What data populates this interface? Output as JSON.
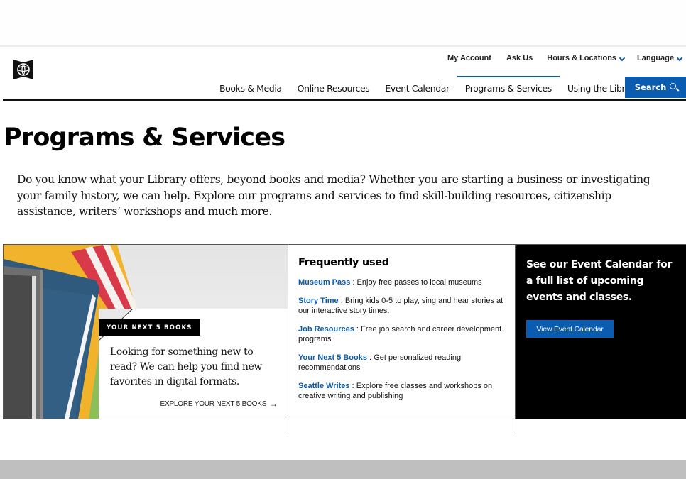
{
  "header": {
    "logo_icon": "library-globe-logo-icon",
    "utility_nav": [
      {
        "label": "My Account"
      },
      {
        "label": "Ask Us"
      },
      {
        "label": "Hours & Locations",
        "dropdown": true
      },
      {
        "label": "Language",
        "dropdown": true
      }
    ],
    "main_nav": [
      {
        "label": "Books & Media"
      },
      {
        "label": "Online Resources"
      },
      {
        "label": "Event Calendar"
      },
      {
        "label": "Programs & Services",
        "active": true
      },
      {
        "label": "Using the Library"
      }
    ],
    "search_label": "Search",
    "search_icon": "magnifier-icon"
  },
  "page": {
    "title": "Programs & Services",
    "intro": "Do you know what your Library offers, beyond books and media? Whether you are starting a business or investigating your family history, we can help. Explore our programs and services to find skill-building resources, citizenship assistance, writers’ workshops and much more."
  },
  "promo_books": {
    "tag": "YOUR NEXT 5 BOOKS",
    "text": "Looking for something new to read? We can help you find new favorites in digital formats.",
    "link_label": "EXPLORE YOUR NEXT 5 BOOKS",
    "link_icon": "arrow-right-icon"
  },
  "frequently_used": {
    "title": "Frequently used",
    "items": [
      {
        "link": "Museum Pass",
        "desc": " : Enjoy free passes to local museums"
      },
      {
        "link": "Story Time",
        "desc": " : Bring kids 0-5 to play, sing and hear stories at our interactive story times."
      },
      {
        "link": "Job Resources",
        "desc": " : Free job search and career development programs"
      },
      {
        "link": "Your Next 5 Books",
        "desc": " : Get personalized reading recommendations"
      },
      {
        "link": "Seattle Writes",
        "desc": " : Explore free classes and workshops on creative writing and publishing"
      }
    ]
  },
  "event_panel": {
    "text": "See our Event Calendar for a full list of upcoming events and classes.",
    "button_label": "View Event Calendar"
  },
  "colors": {
    "accent_blue": "#0a5cb0",
    "black": "#000000",
    "footer_gray": "#bfbfbf"
  }
}
